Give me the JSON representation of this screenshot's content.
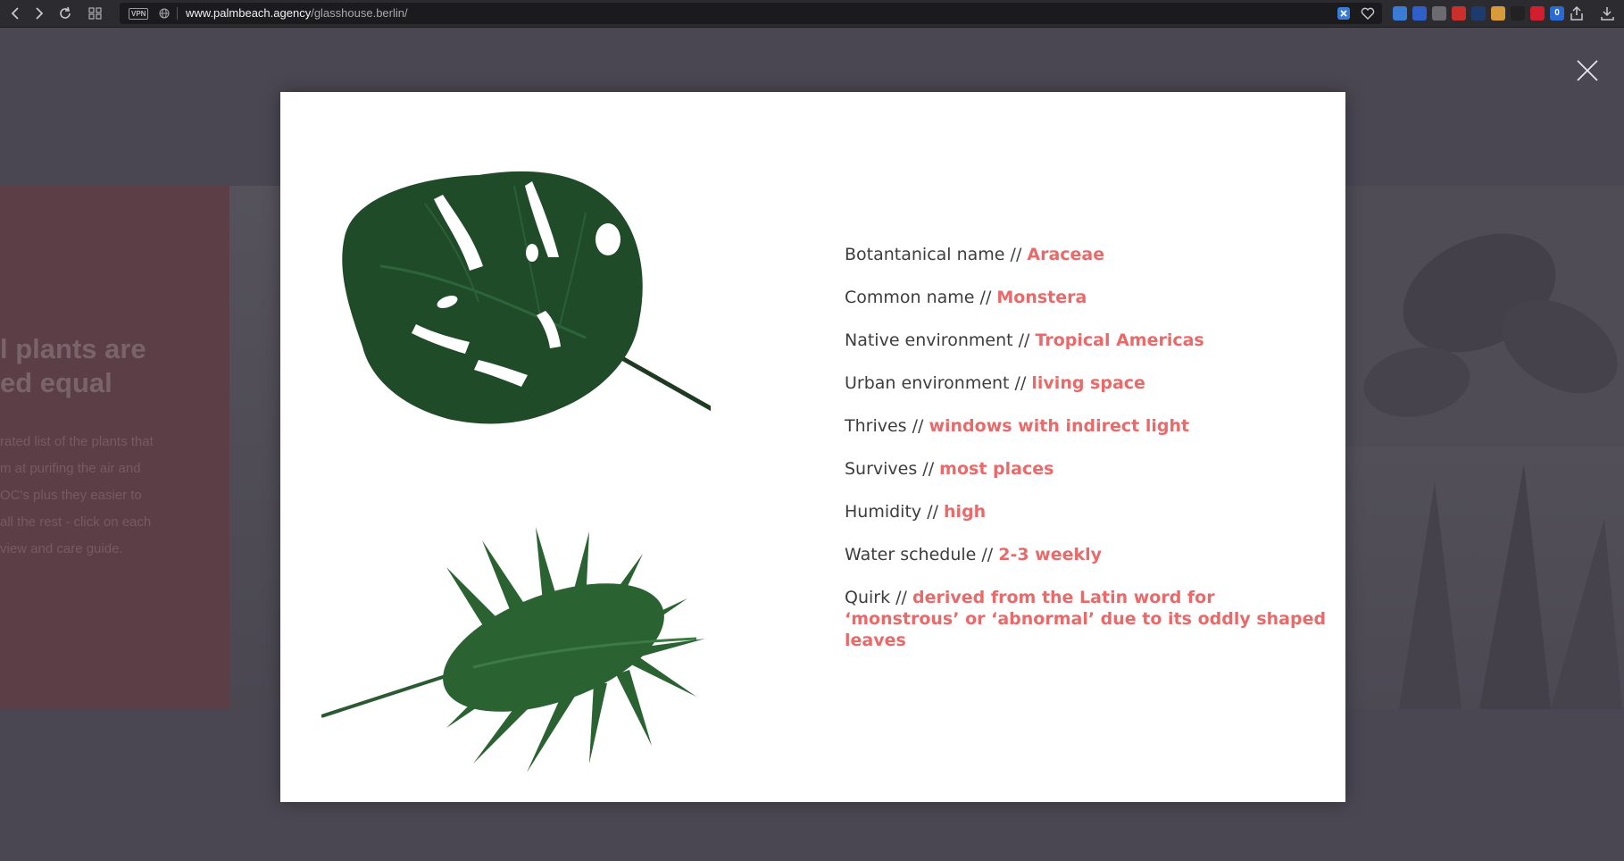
{
  "browser": {
    "vpn_label": "VPN",
    "url_host": "www.palmbeach.agency",
    "url_path": "/glasshouse.berlin/",
    "extensions": [
      {
        "name": "zotero-icon",
        "color": "#3a7bd5"
      },
      {
        "name": "z-icon",
        "color": "#2f5fc9"
      },
      {
        "name": "circle-icon",
        "color": "#6b6b72"
      },
      {
        "name": "red-extension-icon",
        "color": "#c9302c"
      },
      {
        "name": "bw-icon",
        "color": "#1e3b6e"
      },
      {
        "name": "cookie-icon",
        "color": "#d99a3a"
      },
      {
        "name": "fs-icon",
        "color": "#222222"
      },
      {
        "name": "pin-icon",
        "color": "#d11f2f"
      },
      {
        "name": "counter-icon",
        "color": "#2a6ad4"
      }
    ],
    "counter_label": "0"
  },
  "background": {
    "heading_line1": "l plants are",
    "heading_line2": "ed equal",
    "para": [
      "rated list of the plants that",
      "m at purifing the air and",
      "OC's plus they easier to",
      "all the rest - click on each",
      "view and care guide."
    ]
  },
  "plant": {
    "rows": [
      {
        "label": "Botantanical name // ",
        "value": "Araceae"
      },
      {
        "label": "Common name // ",
        "value": "Monstera"
      },
      {
        "label": "Native environment //  ",
        "value": "Tropical Americas"
      },
      {
        "label": "Urban environment // ",
        "value": "living space"
      },
      {
        "label": "Thrives //  ",
        "value": "windows  with indirect light"
      },
      {
        "label": "Survives // ",
        "value": "most places"
      },
      {
        "label": "Humidity // ",
        "value": "high"
      },
      {
        "label": "Water schedule // ",
        "value": "2-3 weekly"
      },
      {
        "label": "Quirk // ",
        "value": "derived from the Latin word for ‘monstrous’ or ‘abnormal’ due to its oddly shaped leaves"
      }
    ]
  },
  "colors": {
    "accent": "#e86a6a",
    "overlay": "#4a4752",
    "leaf": "#1f4a2a"
  }
}
